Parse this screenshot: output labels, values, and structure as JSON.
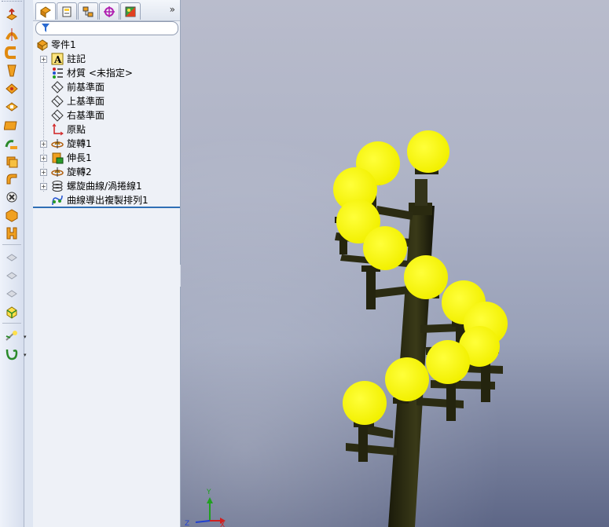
{
  "left_toolbar": {
    "buttons": [
      "extruded-boss-icon",
      "revolved-boss-icon",
      "swept-boss-icon",
      "lofted-boss-icon",
      "boundary-boss-icon",
      "extruded-cut-icon",
      "revolved-cut-icon",
      "swept-cut-icon",
      "lofted-cut-icon",
      "fillet-icon",
      "linear-pattern-icon",
      "rib-icon",
      "draft-icon",
      "shell-icon",
      "wrap-icon",
      "dome-icon",
      "intersect-icon",
      "reference-geometry-icon",
      "curves-icon"
    ]
  },
  "feature_manager": {
    "tabs": [
      "feature-manager-tab",
      "property-manager-tab",
      "configuration-manager-tab",
      "dimxpert-manager-tab",
      "display-manager-tab"
    ],
    "more_label": "»",
    "filter_placeholder": "",
    "tree": [
      {
        "id": "part",
        "label": "零件1",
        "icon": "part-icon",
        "expandable": false
      },
      {
        "id": "annotations",
        "label": "註記",
        "icon": "annotations-icon",
        "expandable": true
      },
      {
        "id": "material",
        "label": "材質 <未指定>",
        "icon": "material-icon",
        "expandable": false
      },
      {
        "id": "front-plane",
        "label": "前基準面",
        "icon": "plane-icon",
        "expandable": false
      },
      {
        "id": "top-plane",
        "label": "上基準面",
        "icon": "plane-icon",
        "expandable": false
      },
      {
        "id": "right-plane",
        "label": "右基準面",
        "icon": "plane-icon",
        "expandable": false
      },
      {
        "id": "origin",
        "label": "原點",
        "icon": "origin-icon",
        "expandable": false
      },
      {
        "id": "revolve1",
        "label": "旋轉1",
        "icon": "revolve-icon",
        "expandable": true
      },
      {
        "id": "extrude1",
        "label": "伸長1",
        "icon": "extrude-icon",
        "expandable": true
      },
      {
        "id": "revolve2",
        "label": "旋轉2",
        "icon": "revolve-icon",
        "expandable": true
      },
      {
        "id": "helix1",
        "label": "螺旋曲線/渦捲線1",
        "icon": "helix-icon",
        "expandable": true
      },
      {
        "id": "curve-pattern1",
        "label": "曲線導出複製排列1",
        "icon": "curve-pattern-icon",
        "expandable": false
      }
    ]
  },
  "graphics": {
    "lamp_color": "#ffff1a",
    "pole_color": "#2a2a12",
    "triad": {
      "x": "X",
      "y": "Y",
      "z": "Z"
    }
  }
}
